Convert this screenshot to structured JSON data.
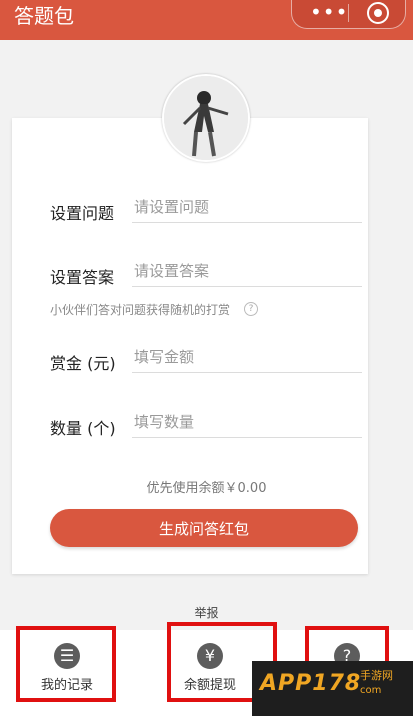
{
  "topbar": {
    "title": "答题包",
    "menu_icon": "more-dots-icon",
    "target_icon": "target-icon"
  },
  "form": {
    "question": {
      "label": "设置问题",
      "placeholder": "请设置问题"
    },
    "answer": {
      "label": "设置答案",
      "placeholder": "请设置答案"
    },
    "hint": "小伙伴们答对问题获得随机的打赏",
    "reward": {
      "label": "赏金 (元)",
      "placeholder": "填写金额"
    },
    "quantity": {
      "label": "数量 (个)",
      "placeholder": "填写数量"
    },
    "balance_note": "优先使用余额￥0.00",
    "generate_button": "生成问答红包"
  },
  "report_link": "举报",
  "bottom_nav": [
    {
      "label": "我的记录",
      "icon": "list-icon"
    },
    {
      "label": "余额提现",
      "icon": "yen-icon"
    },
    {
      "label": "",
      "icon": "question-icon"
    }
  ],
  "watermark": {
    "main": "APP178",
    "sub": "手游网",
    "sub2": "com"
  },
  "colors": {
    "accent": "#d9573f",
    "highlight_box": "#e01010"
  }
}
